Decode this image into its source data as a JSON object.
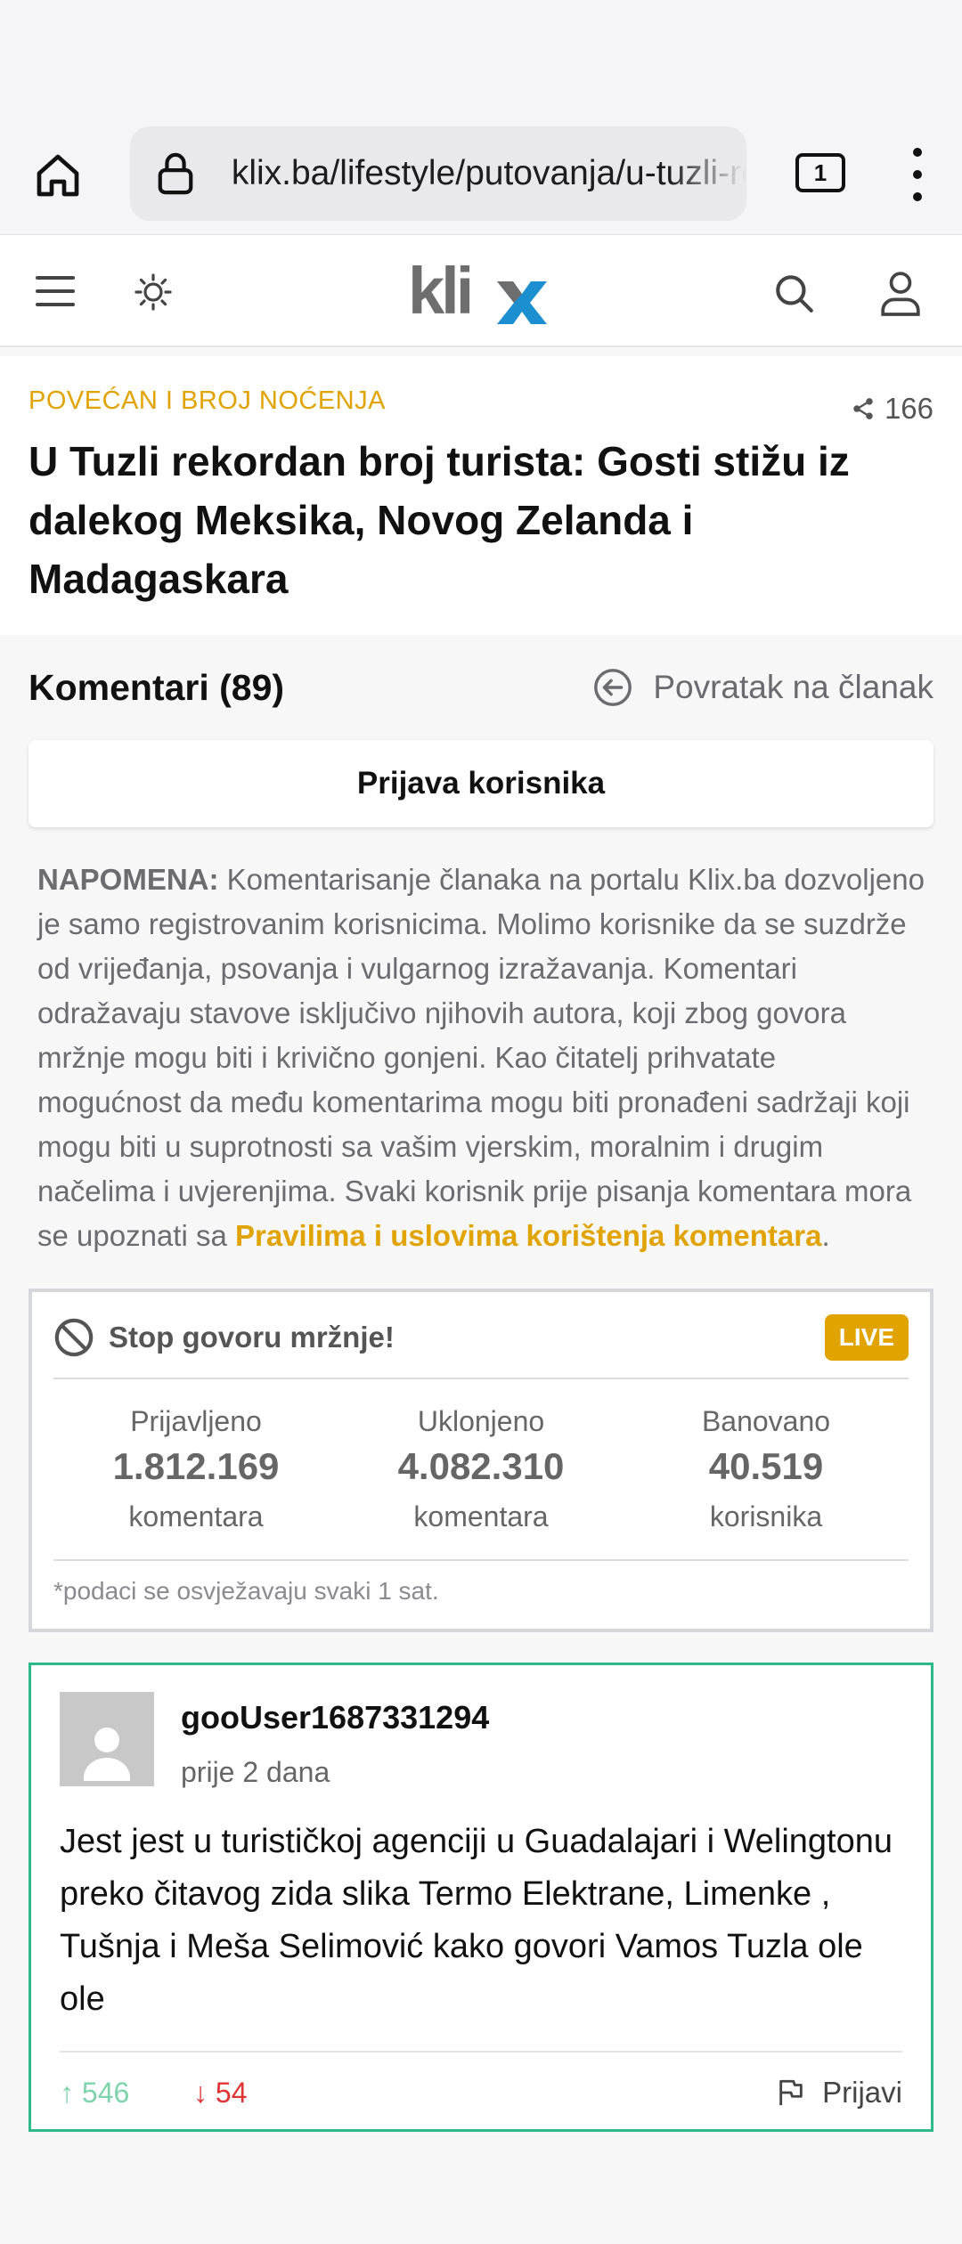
{
  "browser": {
    "url": "klix.ba/lifestyle/putovanja/u-tuzli-rekordan-broj-turista",
    "tab_count": "1"
  },
  "header": {
    "logo_text": "klix",
    "brand_colors": {
      "grey": "#6e6e6e",
      "blue": "#1c8fd0"
    }
  },
  "article": {
    "kicker": "POVEĆAN I BROJ NOĆENJA",
    "shares": "166",
    "title": "U Tuzli rekordan broj turista: Gosti stižu iz dalekog Meksika, Novog Zelanda i Madagaskara"
  },
  "comments": {
    "title": "Komentari (89)",
    "back_link": "Povratak na članak",
    "login_button": "Prijava korisnika",
    "note_label": "NAPOMENA:",
    "note_text": " Komentarisanje članaka na portalu Klix.ba dozvoljeno je samo registrovanim korisnicima. Molimo korisnike da se suzdrže od vrijeđanja, psovanja i vulgarnog izražavanja. Komentari odražavaju stavove isključivo njihovih autora, koji zbog govora mržnje mogu biti i krivično gonjeni. Kao čitatelj prihvatate mogućnost da među komentarima mogu biti pronađeni sadržaji koji mogu biti u suprotnosti sa vašim vjerskim, moralnim i drugim načelima i uvjerenjima. Svaki korisnik prije pisanja komentara mora se upoznati sa ",
    "rules_link": "Pravilima i uslovima korištenja komentara",
    "note_end": "."
  },
  "stop_box": {
    "title": "Stop govoru mržnje!",
    "badge": "LIVE",
    "stats": [
      {
        "label": "Prijavljeno",
        "value": "1.812.169",
        "unit": "komentara"
      },
      {
        "label": "Uklonjeno",
        "value": "4.082.310",
        "unit": "komentara"
      },
      {
        "label": "Banovano",
        "value": "40.519",
        "unit": "korisnika"
      }
    ],
    "footnote": "*podaci se osvježavaju svaki 1 sat."
  },
  "comment": {
    "user": "gooUser1687331294",
    "time": "prije 2 dana",
    "body": "Jest jest u turističkoj agenciji u Guadalajari i Welingtonu preko čitavog zida slika Termo Elektrane, Limenke , Tušnja i Meša Selimović kako govori Vamos Tuzla ole ole",
    "upvotes": "↑ 546",
    "downvotes": "↓ 54",
    "report": "Prijavi"
  }
}
